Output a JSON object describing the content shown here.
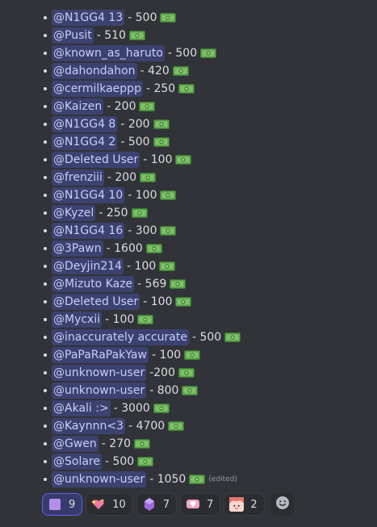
{
  "entries": [
    {
      "user": "@N1GG4 13",
      "amount": "- 500"
    },
    {
      "user": "@Pusit",
      "amount": " - 510"
    },
    {
      "user": "@known_as_haruto",
      "amount": "- 500"
    },
    {
      "user": "@dahondahon",
      "amount": "- 420"
    },
    {
      "user": "@cermilkaeppp",
      "amount": " - 250"
    },
    {
      "user": "@Kaizen",
      "amount": " - 200"
    },
    {
      "user": "@N1GG4 8",
      "amount": " - 200"
    },
    {
      "user": "@N1GG4 2",
      "amount": " - 500"
    },
    {
      "user": "@Deleted User",
      "amount": "- 100"
    },
    {
      "user": "@frenziii",
      "amount": "- 200"
    },
    {
      "user": "@N1GG4 10",
      "amount": " - 100"
    },
    {
      "user": "@Kyzel",
      "amount": " - 250"
    },
    {
      "user": "@N1GG4 16",
      "amount": " - 300"
    },
    {
      "user": "@3Pawn",
      "amount": " - 1600"
    },
    {
      "user": "@Deyjin214",
      "amount": "- 100"
    },
    {
      "user": "@Mizuto Kaze",
      "amount": "- 569"
    },
    {
      "user": "@Deleted User",
      "amount": "- 100"
    },
    {
      "user": "@Mycxii",
      "amount": " - 100"
    },
    {
      "user": "@inaccurately accurate",
      "amount": "- 500"
    },
    {
      "user": "@PaPaRaPakYaw",
      "amount": "- 100"
    },
    {
      "user": "@unknown-user",
      "amount": " -200"
    },
    {
      "user": "@unknown-user",
      "amount": " - 800"
    },
    {
      "user": "@Akali :>",
      "amount": " - 3000"
    },
    {
      "user": "@Kaynnn<3",
      "amount": " - 4700"
    },
    {
      "user": "@Gwen",
      "amount": " - 270"
    },
    {
      "user": "@Solare",
      "amount": "- 500"
    },
    {
      "user": "@unknown-user",
      "amount": " - 1050"
    }
  ],
  "edited_label": "(edited)",
  "reactions": [
    {
      "emoji": "purple-square",
      "count": "9",
      "active": true
    },
    {
      "emoji": "heart-stars",
      "count": "10",
      "active": false
    },
    {
      "emoji": "purple-gem",
      "count": "7",
      "active": false
    },
    {
      "emoji": "pink-heart",
      "count": "7",
      "active": false
    },
    {
      "emoji": "avatar-face",
      "count": "2",
      "active": false
    }
  ],
  "colors": {
    "background": "#313338",
    "mention_bg": "#3c4270",
    "mention_text": "#c9cdfb",
    "money_green": "#5fa04e",
    "reaction_active_border": "#5865f2"
  }
}
